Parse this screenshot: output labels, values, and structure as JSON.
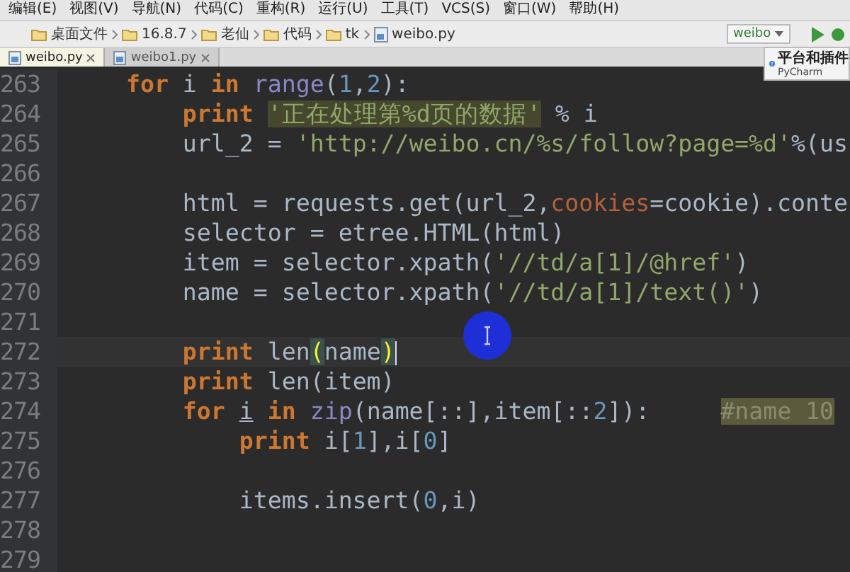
{
  "menu": [
    "编辑(E)",
    "视图(V)",
    "导航(N)",
    "代码(C)",
    "重构(R)",
    "运行(U)",
    "工具(T)",
    "VCS(S)",
    "窗口(W)",
    "帮助(H)"
  ],
  "breadcrumbs": [
    "桌面文件",
    "16.8.7",
    "老仙",
    "代码",
    "tk",
    "weibo.py"
  ],
  "run_config": "weibo",
  "tabs": [
    {
      "label": "weibo.py",
      "selected": true
    },
    {
      "label": "weibo1.py",
      "selected": false
    }
  ],
  "notification": {
    "title": "平台和插件",
    "subtitle": "PyCharm"
  },
  "lines": [
    {
      "number": "263",
      "current": false,
      "tokens": [
        {
          "kind": "kw",
          "text": "    for"
        },
        {
          "kind": "plain",
          "text": " i "
        },
        {
          "kind": "kw",
          "text": "in "
        },
        {
          "kind": "builtin",
          "text": "range"
        },
        {
          "kind": "plain",
          "text": "("
        },
        {
          "kind": "num",
          "text": "1"
        },
        {
          "kind": "plain",
          "text": ","
        },
        {
          "kind": "num",
          "text": "2"
        },
        {
          "kind": "plain",
          "text": "):"
        }
      ]
    },
    {
      "number": "264",
      "current": false,
      "tokens": [
        {
          "kind": "kw",
          "text": "        print "
        },
        {
          "kind": "strhl",
          "text": "'正在处理第%d页的数据'"
        },
        {
          "kind": "plain",
          "text": " % i"
        }
      ]
    },
    {
      "number": "265",
      "current": false,
      "tokens": [
        {
          "kind": "plain",
          "text": "        url_2 = "
        },
        {
          "kind": "str",
          "text": "'http://weibo.cn/%s/follow?page=%d'"
        },
        {
          "kind": "plain",
          "text": "%(us"
        }
      ]
    },
    {
      "number": "266"
    },
    {
      "number": "267",
      "current": false,
      "tokens": [
        {
          "kind": "plain",
          "text": "        html = requests.get(url_2,"
        },
        {
          "kind": "param",
          "text": "cookies"
        },
        {
          "kind": "plain",
          "text": "=cookie).conte"
        }
      ]
    },
    {
      "number": "268",
      "current": false,
      "tokens": [
        {
          "kind": "plain",
          "text": "        selector = etree.HTML(html)"
        }
      ]
    },
    {
      "number": "269",
      "current": false,
      "tokens": [
        {
          "kind": "plain",
          "text": "        item = selector.xpath("
        },
        {
          "kind": "str",
          "text": "'//td/a[1]/@href'"
        },
        {
          "kind": "plain",
          "text": ")"
        }
      ]
    },
    {
      "number": "270",
      "current": false,
      "tokens": [
        {
          "kind": "plain",
          "text": "        name = selector.xpath("
        },
        {
          "kind": "str",
          "text": "'//td/a[1]/text()'"
        },
        {
          "kind": "plain",
          "text": ")"
        }
      ]
    },
    {
      "number": "271"
    },
    {
      "number": "272",
      "current": true,
      "tokens": [
        {
          "kind": "kw",
          "text": "        print "
        },
        {
          "kind": "plain",
          "text": "len"
        },
        {
          "kind": "brace",
          "text": "("
        },
        {
          "kind": "plain",
          "text": "name"
        },
        {
          "kind": "brace",
          "text": ")"
        }
      ]
    },
    {
      "number": "273",
      "current": false,
      "tokens": [
        {
          "kind": "kw",
          "text": "        print "
        },
        {
          "kind": "plain",
          "text": "len(item)"
        }
      ]
    },
    {
      "number": "274",
      "current": false,
      "tokens": [
        {
          "kind": "kw",
          "text": "        for "
        },
        {
          "kind": "under",
          "text": "i"
        },
        {
          "kind": "kw",
          "text": " in "
        },
        {
          "kind": "builtin",
          "text": "zip"
        },
        {
          "kind": "plain",
          "text": "(name[::],item[::"
        },
        {
          "kind": "num",
          "text": "2"
        },
        {
          "kind": "plain",
          "text": "]):     "
        },
        {
          "kind": "comment",
          "text": "#name 10"
        }
      ]
    },
    {
      "number": "275",
      "current": false,
      "tokens": [
        {
          "kind": "kw",
          "text": "            print "
        },
        {
          "kind": "plain",
          "text": "i["
        },
        {
          "kind": "num",
          "text": "1"
        },
        {
          "kind": "plain",
          "text": "],i["
        },
        {
          "kind": "num",
          "text": "0"
        },
        {
          "kind": "plain",
          "text": "]"
        }
      ]
    },
    {
      "number": "276"
    },
    {
      "number": "277",
      "current": false,
      "tokens": [
        {
          "kind": "plain",
          "text": "            items.insert("
        },
        {
          "kind": "num",
          "text": "0"
        },
        {
          "kind": "plain",
          "text": ",i)"
        }
      ]
    },
    {
      "number": "278"
    },
    {
      "number": "279"
    }
  ]
}
